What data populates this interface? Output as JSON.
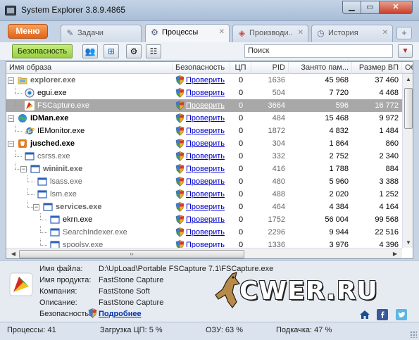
{
  "window": {
    "title": "System Explorer 3.8.9.4865",
    "close_label": "✕"
  },
  "menu_button": "Меню",
  "tabs": [
    {
      "label": "Задачи"
    },
    {
      "label": "Процессы"
    },
    {
      "label": "Производи..."
    },
    {
      "label": "История"
    }
  ],
  "toolbar": {
    "security_label": "Безопасность",
    "search_placeholder": "Поиск"
  },
  "columns": [
    "Имя образа",
    "Безопасность",
    "ЦП",
    "PID",
    "Занято пам...",
    "Размер ВП",
    "Об"
  ],
  "check_label": "Проверить",
  "processes": [
    {
      "name": "explorer.exe",
      "cpu": "0",
      "pid": "1636",
      "mem": "45 968",
      "vm": "37 460"
    },
    {
      "name": "egui.exe",
      "cpu": "0",
      "pid": "504",
      "mem": "7 720",
      "vm": "4 468"
    },
    {
      "name": "FSCapture.exe",
      "cpu": "0",
      "pid": "3664",
      "mem": "596",
      "vm": "16 772"
    },
    {
      "name": "IDMan.exe",
      "cpu": "0",
      "pid": "484",
      "mem": "15 468",
      "vm": "9 972"
    },
    {
      "name": "IEMonitor.exe",
      "cpu": "0",
      "pid": "1872",
      "mem": "4 832",
      "vm": "1 484"
    },
    {
      "name": "jusched.exe",
      "cpu": "0",
      "pid": "304",
      "mem": "1 864",
      "vm": "860"
    },
    {
      "name": "csrss.exe",
      "cpu": "0",
      "pid": "332",
      "mem": "2 752",
      "vm": "2 340"
    },
    {
      "name": "wininit.exe",
      "cpu": "0",
      "pid": "416",
      "mem": "1 788",
      "vm": "884"
    },
    {
      "name": "lsass.exe",
      "cpu": "0",
      "pid": "480",
      "mem": "5 960",
      "vm": "3 388"
    },
    {
      "name": "lsm.exe",
      "cpu": "0",
      "pid": "488",
      "mem": "2 020",
      "vm": "1 252"
    },
    {
      "name": "services.exe",
      "cpu": "0",
      "pid": "464",
      "mem": "4 384",
      "vm": "4 164"
    },
    {
      "name": "ekrn.exe",
      "cpu": "0",
      "pid": "1752",
      "mem": "56 004",
      "vm": "99 568"
    },
    {
      "name": "SearchIndexer.exe",
      "cpu": "0",
      "pid": "2296",
      "mem": "9 944",
      "vm": "22 516"
    },
    {
      "name": "spoolsv.exe",
      "cpu": "0",
      "pid": "1336",
      "mem": "3 976",
      "vm": "4 396"
    }
  ],
  "details": {
    "file_label": "Имя файла:",
    "file_value": "D:\\UpLoad\\Portable FSCapture 7.1\\FSCapture.exe",
    "product_label": "Имя продукта:",
    "product_value": "FastStone Capture",
    "company_label": "Компания:",
    "company_value": "FastStone Soft",
    "desc_label": "Описание:",
    "desc_value": "FastStone Capture",
    "security_label": "Безопасность:",
    "more_link": "Подробнее"
  },
  "watermark": "CWER.RU",
  "status": {
    "processes": "Процессы: 41",
    "cpu_load": "Загрузка ЦП: 5 %",
    "ram": "ОЗУ: 63 %",
    "swap": "Подкачка: 47 %"
  },
  "icons": {
    "app": "system-explorer-icon",
    "tasks": "tasks-icon",
    "processes": "processes-gear-icon",
    "performance": "performance-icon",
    "history": "history-clock-icon",
    "security_shield": "security-shield-icon"
  }
}
